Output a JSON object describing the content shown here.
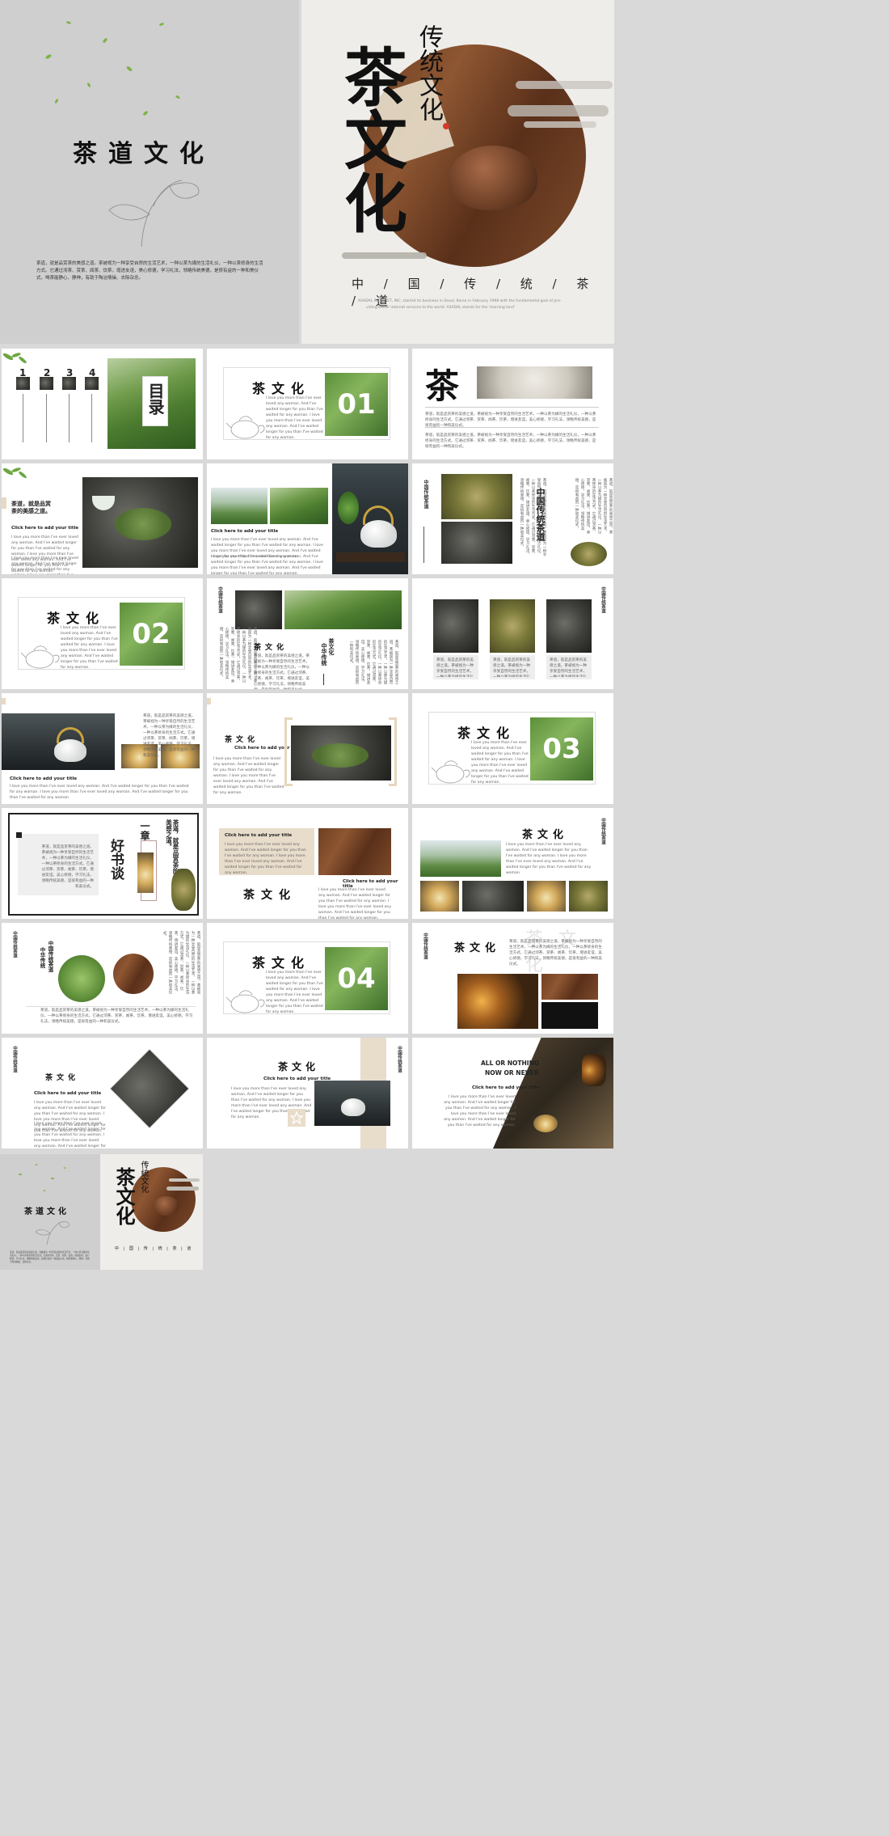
{
  "cover": {
    "title": "茶道文化",
    "paragraph": "茶道，就是品赏茶的美感之道。茶被视为一种享受自然的生活艺术，一种以茶为媒的生活礼仪，一种以茶修身的生活方式。它通过沏茶、赏茶、闻茶、饮茶，增进友谊，美心修德，学习礼法，领略传统美德，是很有益的一种和美仪式。喝茶能静心、静神，有助于陶冶情操、去除杂念。",
    "hero_vertical": "传统文化",
    "hero_big": "茶文化",
    "hero_line": "中 / 国 / 传 / 统 / 茶 / 道",
    "hero_small_1": "ASADAL INTERNET, INC. started its business in Seoul, Korea in February 1998 with the fundamental goal of pro-",
    "hero_small_2": "viding better internet services to the world. ASADAL stands for the 'morning land'"
  },
  "common": {
    "tea_culture": "茶文化",
    "click_title": "Click here to add your title",
    "body_en": "I love you more than I've ever loved any woman. And I've waited longer for you than I've waited for any woman. I love you more than I've ever loved any woman. And I've waited longer for you than I've waited for any woman.",
    "china_tea": "中国传统茶道",
    "cn_body": "茶道，就是品赏茶的美感之道。茶被视为一种享受自然的生活艺术，一种以茶为媒的生活礼仪，一种以茶修身的生活方式。它通过沏茶、赏茶、闻茶、饮茶，增进友谊，美心修德，学习礼法，领略传统美德，是很有益的一种和美仪式。"
  },
  "slides": {
    "toc_nums": [
      "1",
      "2",
      "3",
      "4"
    ],
    "toc_title": "目录",
    "sec_01": "01",
    "sec_02": "02",
    "sec_03": "03",
    "sec_04": "04",
    "cha": "茶",
    "quote": "茶道，就是品赏茶的美感之道。",
    "china_tea_vertical": "中华传统",
    "book_title": "好书谈",
    "chapter": "一章",
    "chapter_text": "茶道，就是品赏茶的美感之道。",
    "ghost": "茶 文 化",
    "all_or_nothing": "ALL OR NOTHING",
    "now_or_never": "NOW OR NEVER"
  },
  "mini_cover": {
    "title": "茶道文化",
    "hero_vertical": "传统文化",
    "hero_big": "茶文化",
    "hero_line": "中 | 国 | 传 | 统 | 茶 | 道"
  }
}
